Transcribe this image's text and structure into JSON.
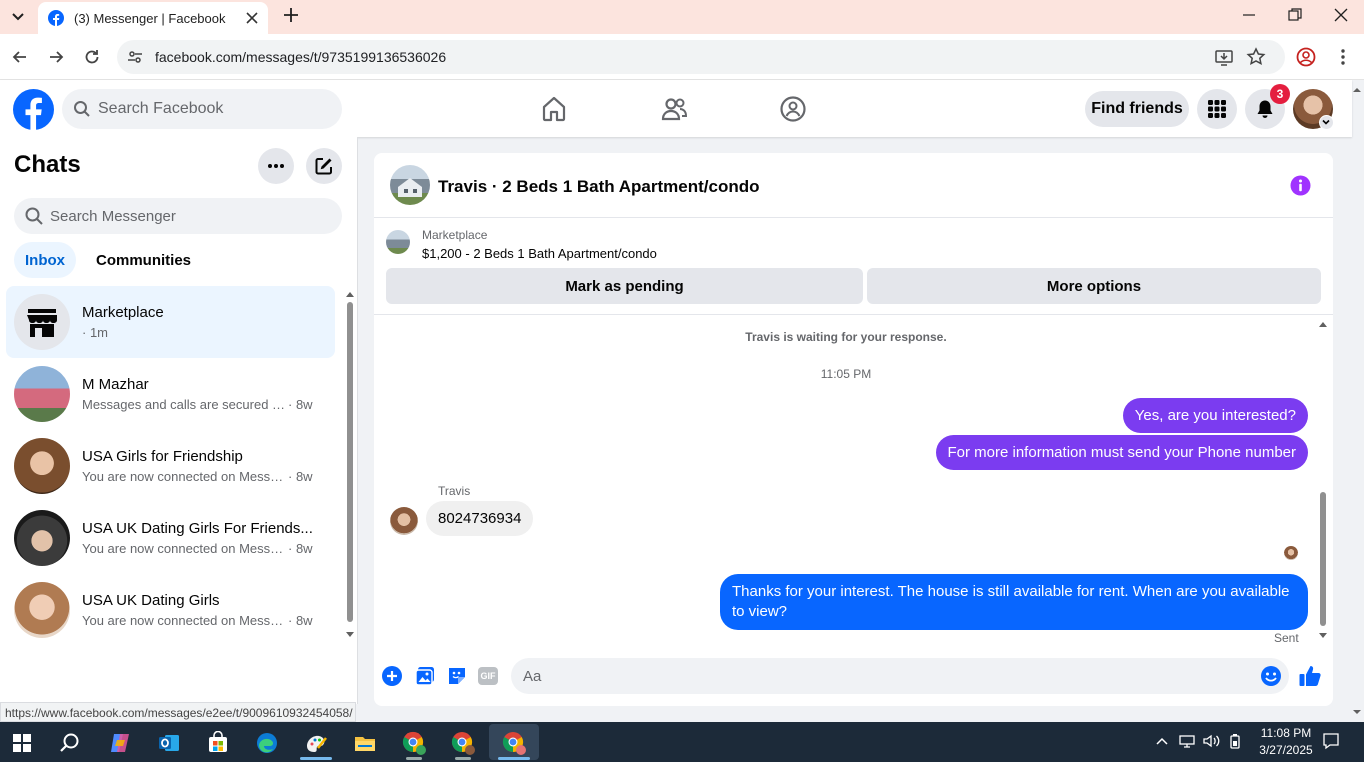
{
  "browser": {
    "tab_title": "(3) Messenger | Facebook",
    "url": "facebook.com/messages/t/9735199136536026",
    "status_url": "https://www.facebook.com/messages/e2ee/t/9009610932454058/"
  },
  "header": {
    "search_placeholder": "Search Facebook",
    "find_friends": "Find friends",
    "notification_count": "3"
  },
  "sidebar": {
    "title": "Chats",
    "search_placeholder": "Search Messenger",
    "tabs": [
      {
        "label": "Inbox",
        "active": true
      },
      {
        "label": "Communities",
        "active": false
      }
    ],
    "chats": [
      {
        "name": "Marketplace",
        "snippet": "",
        "time": "· 1m",
        "active": true
      },
      {
        "name": "M Mazhar",
        "snippet": "Messages and calls are secured wit...",
        "time": "· 8w"
      },
      {
        "name": "USA Girls for Friendship",
        "snippet": "You are now connected on Messen...",
        "time": "· 8w"
      },
      {
        "name": "USA UK Dating Girls For Friends...",
        "snippet": "You are now connected on Messen...",
        "time": "· 8w"
      },
      {
        "name": "USA UK Dating Girls",
        "snippet": "You are now connected on Messen...",
        "time": "· 8w"
      }
    ]
  },
  "conversation": {
    "title": "Travis · 2 Beds 1 Bath Apartment/condo",
    "listing": {
      "source": "Marketplace",
      "price_title": "$1,200 - 2 Beds 1 Bath Apartment/condo"
    },
    "actions": {
      "mark_pending": "Mark as pending",
      "more_options": "More options"
    },
    "system_message": "Travis is waiting for your response.",
    "timestamp": "11:05 PM",
    "messages": [
      {
        "from": "me",
        "text": "Yes, are you interested?"
      },
      {
        "from": "me",
        "text": "For more information must send your Phone number"
      },
      {
        "from": "Travis",
        "sender_label": "Travis",
        "text": "8024736934"
      },
      {
        "from": "me",
        "text": "Thanks for your interest. The house is still available for rent. When are you available to view?"
      }
    ],
    "delivery_status": "Sent",
    "composer_placeholder": "Aa",
    "gif_label": "GIF"
  },
  "taskbar": {
    "time": "11:08 PM",
    "date": "3/27/2025"
  },
  "colors": {
    "fb_blue": "#0866ff",
    "messenger_purple": "#7b3cf0",
    "tab_bar_bg": "#fce4de",
    "taskbar_bg": "#1c2a39"
  }
}
